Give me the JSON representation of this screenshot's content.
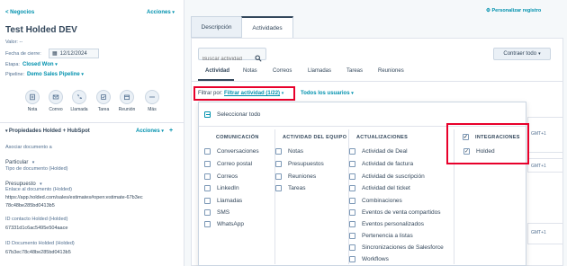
{
  "left": {
    "back_link": "< Negocios",
    "actions_label": "Acciones",
    "deal_title": "Test Holded DEV",
    "valor_label": "Valor: --",
    "close_date_label": "Fecha de cierre:",
    "close_date_value": "12/12/2024",
    "stage_label": "Etapa:",
    "stage_value": "Closed Won",
    "pipeline_label": "Pipeline:",
    "pipeline_value": "Demo Sales Pipeline",
    "activity_buttons": [
      "Nota",
      "Correo",
      "Llamada",
      "Tarea",
      "Reunión",
      "Más"
    ],
    "section_title": "Propiedades Holded + HubSpot",
    "section_actions": "Acciones",
    "props": [
      {
        "label": "Asociar documento a",
        "value": "Particular"
      },
      {
        "label": "Tipo de documento (Holded)",
        "value": "Presupuesto"
      },
      {
        "label": "Enlace al documento (Holded)",
        "value": "https://app.holded.com/sales/estimates#open:estimate-67b3ec78c48be285bd0413b5"
      },
      {
        "label": "ID contacto Holded (Holded)",
        "value": "67331d1c6ac5495e504aace"
      },
      {
        "label": "ID Documento Holded (Holded)",
        "value": "67b3ec78c48be285bd0413b5"
      }
    ]
  },
  "main": {
    "personalize": "Personalizar registro",
    "tabs": [
      "Descripción",
      "Actividades"
    ],
    "search_placeholder": "Buscar actividad",
    "collapse_all": "Contraer todo",
    "subtabs": [
      "Actividad",
      "Notas",
      "Correos",
      "Llamadas",
      "Tareas",
      "Reuniones"
    ],
    "filter_label": "Filtrar por:",
    "filter_value": "Filtrar actividad (1/22)",
    "users_filter": "Todos los usuarios",
    "right_fragments": [
      "GMT+1",
      "GMT+1",
      "GMT+1"
    ]
  },
  "popover": {
    "select_all": "Seleccionar todo",
    "columns": [
      {
        "title": "COMUNICACIÓN",
        "items": [
          "Conversaciones",
          "Correo postal",
          "Correos",
          "LinkedIn",
          "Llamadas",
          "SMS",
          "WhatsApp"
        ]
      },
      {
        "title": "ACTIVIDAD DEL EQUIPO",
        "items": [
          "Notas",
          "Presupuestos",
          "Reuniones",
          "Tareas"
        ]
      },
      {
        "title": "ACTUALIZACIONES",
        "items": [
          "Actividad de Deal",
          "Actividad de factura",
          "Actividad de suscripción",
          "Actividad del ticket",
          "Combinaciones",
          "Eventos de venta compartidos",
          "Eventos personalizados",
          "Pertenencia a listas",
          "Sincronizaciones de Salesforce",
          "Workflows"
        ]
      },
      {
        "title": "INTEGRACIONES",
        "items": [
          "Holded"
        ]
      }
    ]
  },
  "colors": {
    "accent": "#0091ae",
    "highlight": "#e8002b",
    "active_tab_border": "#33475b"
  }
}
